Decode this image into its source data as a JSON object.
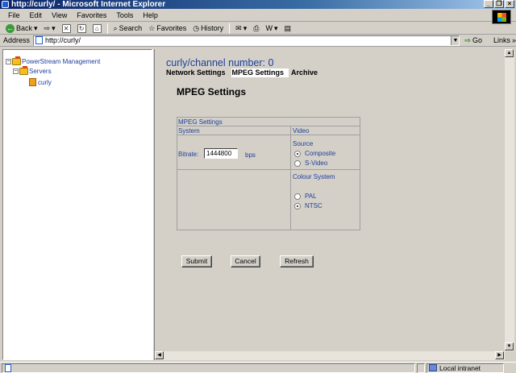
{
  "window": {
    "title": "http://curly/ - Microsoft Internet Explorer"
  },
  "menu": [
    "File",
    "Edit",
    "View",
    "Favorites",
    "Tools",
    "Help"
  ],
  "toolbar": {
    "back": "Back",
    "search": "Search",
    "favorites": "Favorites",
    "history": "History"
  },
  "address": {
    "label": "Address",
    "url": "http://curly/",
    "go": "Go",
    "links": "Links"
  },
  "tree": {
    "root": "PowerStream Management",
    "servers": "Servers",
    "server": "curly"
  },
  "page": {
    "channel_title": "curly/channel number: 0",
    "tabs": [
      "Network Settings",
      "MPEG Settings",
      "Archive"
    ],
    "active_tab": "MPEG Settings",
    "section_title": "MPEG Settings"
  },
  "panel": {
    "header": "MPEG Settings",
    "col_system": "System",
    "col_video": "Video",
    "bitrate_label": "Bitrate:",
    "bitrate_value": "1444800",
    "bitrate_unit": "bps",
    "source_label": "Source",
    "source_options": [
      "Composite",
      "S-Video"
    ],
    "source_selected": "Composite",
    "colour_label": "Colour System",
    "colour_options": [
      "PAL",
      "NTSC"
    ],
    "colour_selected": "NTSC"
  },
  "buttons": {
    "submit": "Submit",
    "cancel": "Cancel",
    "refresh": "Refresh"
  },
  "status": {
    "zone": "Local intranet"
  }
}
